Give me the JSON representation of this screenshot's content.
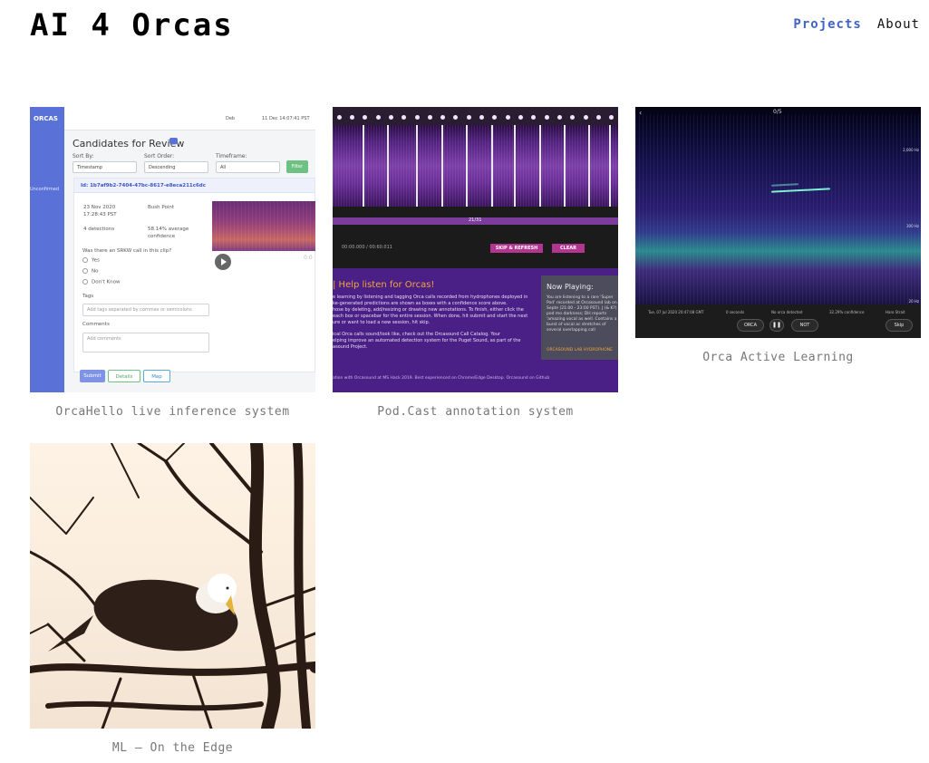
{
  "site": {
    "title": "AI 4 Orcas"
  },
  "nav": {
    "items": [
      "Projects",
      "About"
    ]
  },
  "projects": [
    {
      "caption": "OrcaHello live inference system",
      "screenshot": {
        "brand": "ORCAS",
        "sidebar_items": [
          "Unconfirmed"
        ],
        "topbar_user": "Deb",
        "topbar_time": "11 Dec 14:07:41 PST",
        "heading": "Candidates for Review",
        "filters": {
          "sort_by_label": "Sort By:",
          "sort_by_value": "Timestamp",
          "sort_order_label": "Sort Order:",
          "sort_order_value": "Descending",
          "timeframe_label": "Timeframe:",
          "timeframe_value": "All",
          "filter_button": "Filter"
        },
        "candidate": {
          "id": "Id: 1b7af9b2-7404-47bc-8617-e8eca211c6dc",
          "date": "23 Nov 2020",
          "time": "17:28:43 PST",
          "location": "Bush Point",
          "detections": "4 detections",
          "confidence": "58.14% average confidence",
          "question": "Was there an SRKW call in this clip?",
          "options": [
            "Yes",
            "No",
            "Don't Know"
          ],
          "tags_label": "Tags",
          "tags_placeholder": "Add tags separated by commas or semicolons",
          "comments_label": "Comments",
          "comments_placeholder": "Add comments",
          "audio_time": "0:0"
        },
        "buttons": [
          "Submit",
          "Details",
          "Map"
        ]
      }
    },
    {
      "caption": "Pod.Cast annotation system",
      "screenshot": {
        "progress_text": "21/31",
        "timecode": "00:00.000 / 00:60.011",
        "buttons": [
          "SKIP & REFRESH",
          "CLEAR"
        ],
        "heading": "| Help listen for Orcas!",
        "paragraphs": [
          "e learning by listening and tagging Orca calls recorded from hydrophones deployed in",
          "ke-generated predictions are shown as boxes with a confidence score above.",
          "hose by deleting, add/resizing or drawing new annotations. To finish, either click the",
          "each box or spacebar for the entire session. When done, hit submit and start the next",
          "ure or want to load a new session, hit skip.",
          "ical Orca calls sound/look like, check out the Orcasound Call Catalog. Your",
          "elping improve an automated detection system for the Puget Sound, as part of the",
          "asound Project."
        ],
        "now_playing_title": "Now Playing:",
        "now_playing_text": "You are listening to a rare 'Super Pod' recorded at Orcasound lab on Septe (21:00 - 23:00 PST). J (& K?) pod mo darkness; DH reports 'amazing vocal as well. Contains a burst of vocal ac stretches of several overlapping call",
        "now_playing_link": "ORCASOUND LAB HYDROPHONE",
        "footer": "ation with Orcasound at MS Hack 2019. Best experienced on Chrome/Edge Desktop. Orcasound on Github"
      }
    },
    {
      "caption": "Orca Active Learning",
      "screenshot": {
        "counter": "0/5",
        "freq_labels": [
          "2,000 Hz",
          "300 Hz",
          "20 Hz"
        ],
        "info": [
          "Tue, 07 Jul 2020 20:47:08 GMT",
          "0 seconds",
          "No orca detected",
          "32.29% confidence",
          "Haro Strait"
        ],
        "buttons": [
          "ORCA",
          "NOT",
          "Skip"
        ]
      }
    },
    {
      "caption": "ML – On the Edge"
    }
  ],
  "colors": {
    "nav_active": "#4063c5",
    "caption": "#777777",
    "orcahello_sidebar": "#5a72d8",
    "podcast_accent": "#b3358f",
    "podcast_heading": "#f3a63d"
  }
}
